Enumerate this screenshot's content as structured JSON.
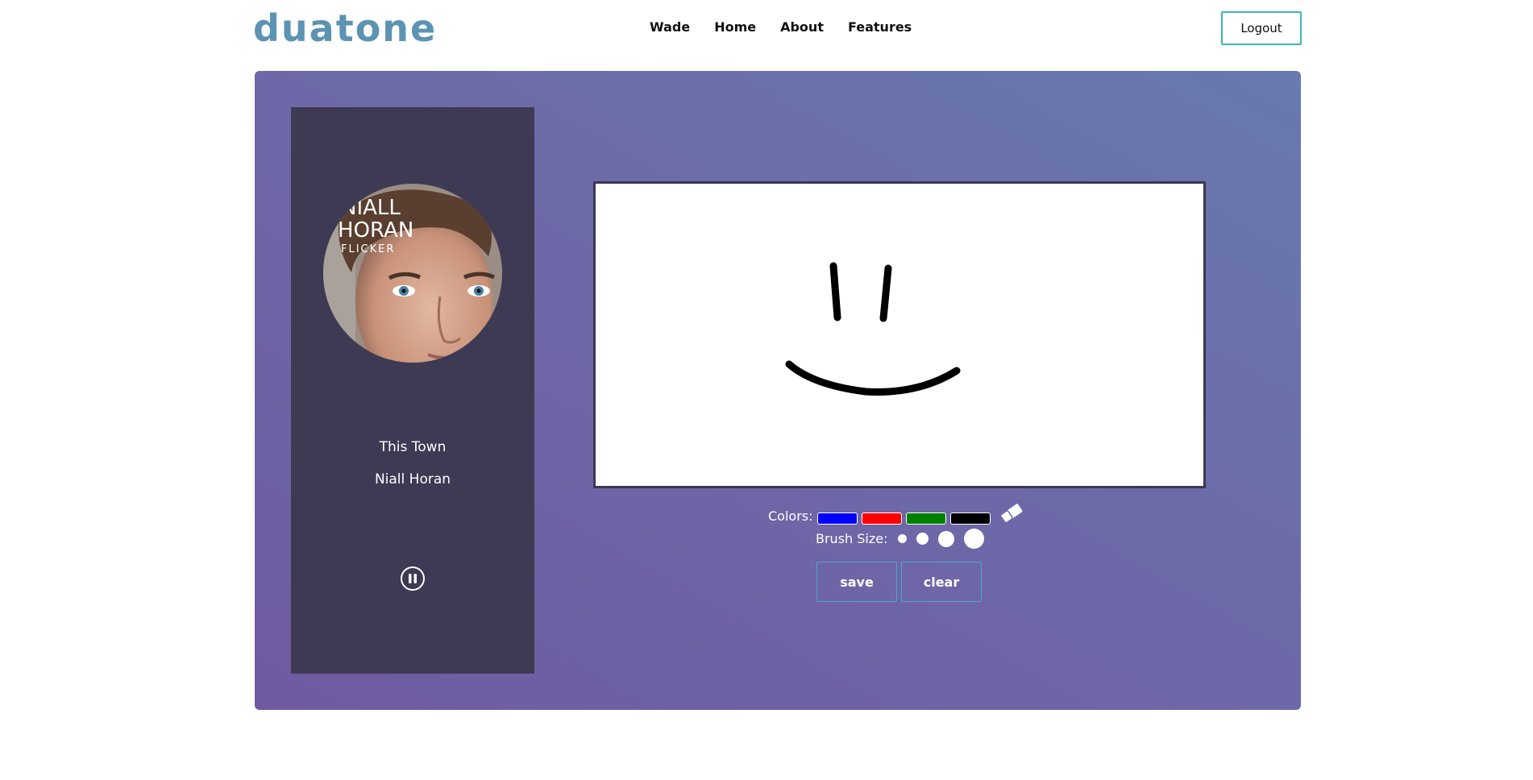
{
  "brand": {
    "name": "duatone"
  },
  "nav": {
    "items": [
      "Wade",
      "Home",
      "About",
      "Features"
    ]
  },
  "header": {
    "logout_label": "Logout"
  },
  "player": {
    "album_text": [
      "NIALL",
      "HORAN",
      "FLICKER"
    ],
    "song_title": "This Town",
    "artist": "Niall Horan",
    "control_icon": "pause-icon"
  },
  "drawing": {
    "colors_label": "Colors:",
    "colors": [
      "#0000ff",
      "#ff0000",
      "#008000",
      "#000000"
    ],
    "eraser_icon": "eraser-icon",
    "brush_label": "Brush Size:",
    "brush_sizes": [
      "small",
      "medium",
      "large",
      "x-large"
    ],
    "save_label": "save",
    "clear_label": "clear"
  }
}
